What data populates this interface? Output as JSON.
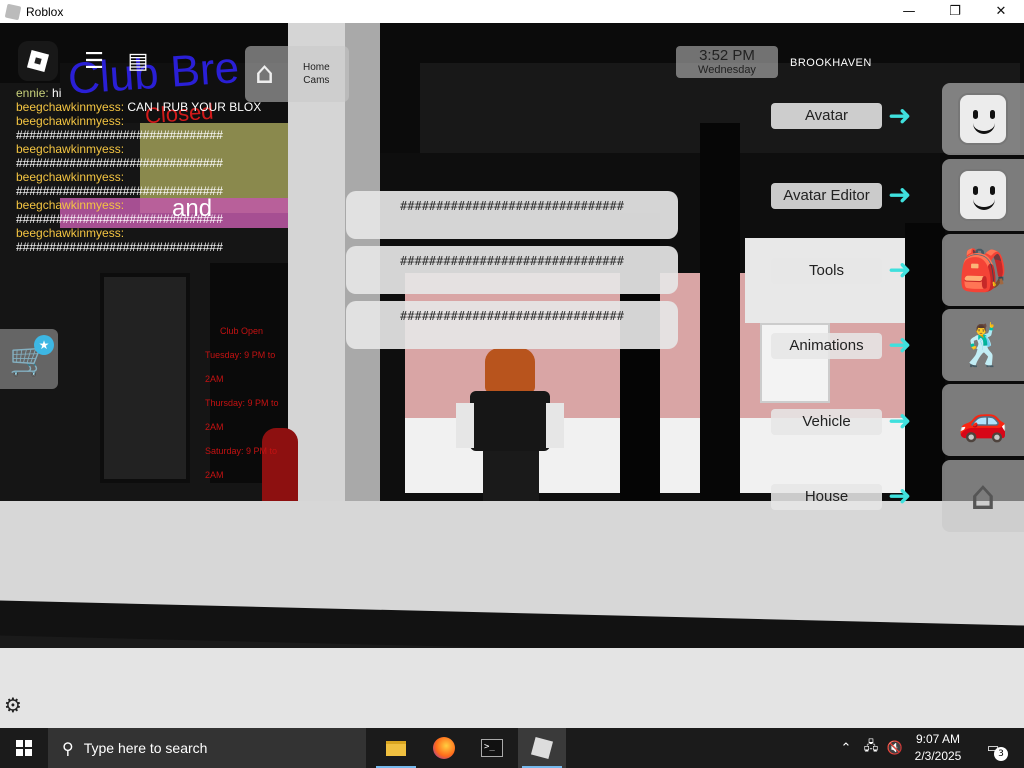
{
  "window": {
    "title": "Roblox",
    "minimize": "—",
    "maximize": "❐",
    "close": "✕"
  },
  "hud": {
    "home_cams": {
      "line1": "Home",
      "line2": "Cams"
    },
    "clock": {
      "time": "3:52 PM",
      "day": "Wednesday"
    },
    "place_name": "BROOKHAVEN"
  },
  "chat": {
    "lines": [
      {
        "name": "ennie:",
        "msg": " hi"
      },
      {
        "name": "beegchawkinmyess:",
        "msg": " CAN I RUB YOUR BLOX"
      },
      {
        "name": "beegchawkinmyess:",
        "msg": ""
      },
      {
        "name": "",
        "msg": "###############################"
      },
      {
        "name": "beegchawkinmyess:",
        "msg": ""
      },
      {
        "name": "",
        "msg": "###############################"
      },
      {
        "name": "beegchawkinmyess:",
        "msg": ""
      },
      {
        "name": "",
        "msg": "###############################"
      },
      {
        "name": "beegchawkinmyess:",
        "msg": ""
      },
      {
        "name": "",
        "msg": "###############################"
      },
      {
        "name": "beegchawkinmyess:",
        "msg": ""
      },
      {
        "name": "",
        "msg": "###############################"
      }
    ]
  },
  "bubbles": [
    "###############################",
    "###############################",
    "###############################"
  ],
  "scene_text": {
    "club_sign": "Club Bre",
    "closed": "Closed",
    "band": "and",
    "hours_title": "Club Open",
    "hours": [
      "Tuesday: 9 PM to 2AM",
      "Thursday: 9 PM to 2AM",
      "Saturday: 9 PM to 2AM"
    ]
  },
  "menu": [
    {
      "label": "Avatar",
      "icon": "avatar-face-icon"
    },
    {
      "label": "Avatar Editor",
      "icon": "avatar-editor-icon"
    },
    {
      "label": "Tools",
      "icon": "backpack-icon"
    },
    {
      "label": "Animations",
      "icon": "animation-figure-icon"
    },
    {
      "label": "Vehicle",
      "icon": "car-icon"
    },
    {
      "label": "House",
      "icon": "house-icon"
    }
  ],
  "menu_arrow": "➜",
  "taskbar": {
    "search_placeholder": "Type here to search",
    "time": "9:07 AM",
    "date": "2/3/2025",
    "notifications": "3"
  },
  "colors": {
    "chat_name": "#f4c542",
    "menu_arrow": "#3fe0dd",
    "club_sign": "#2a1fd6",
    "closed": "#d11a1a"
  }
}
